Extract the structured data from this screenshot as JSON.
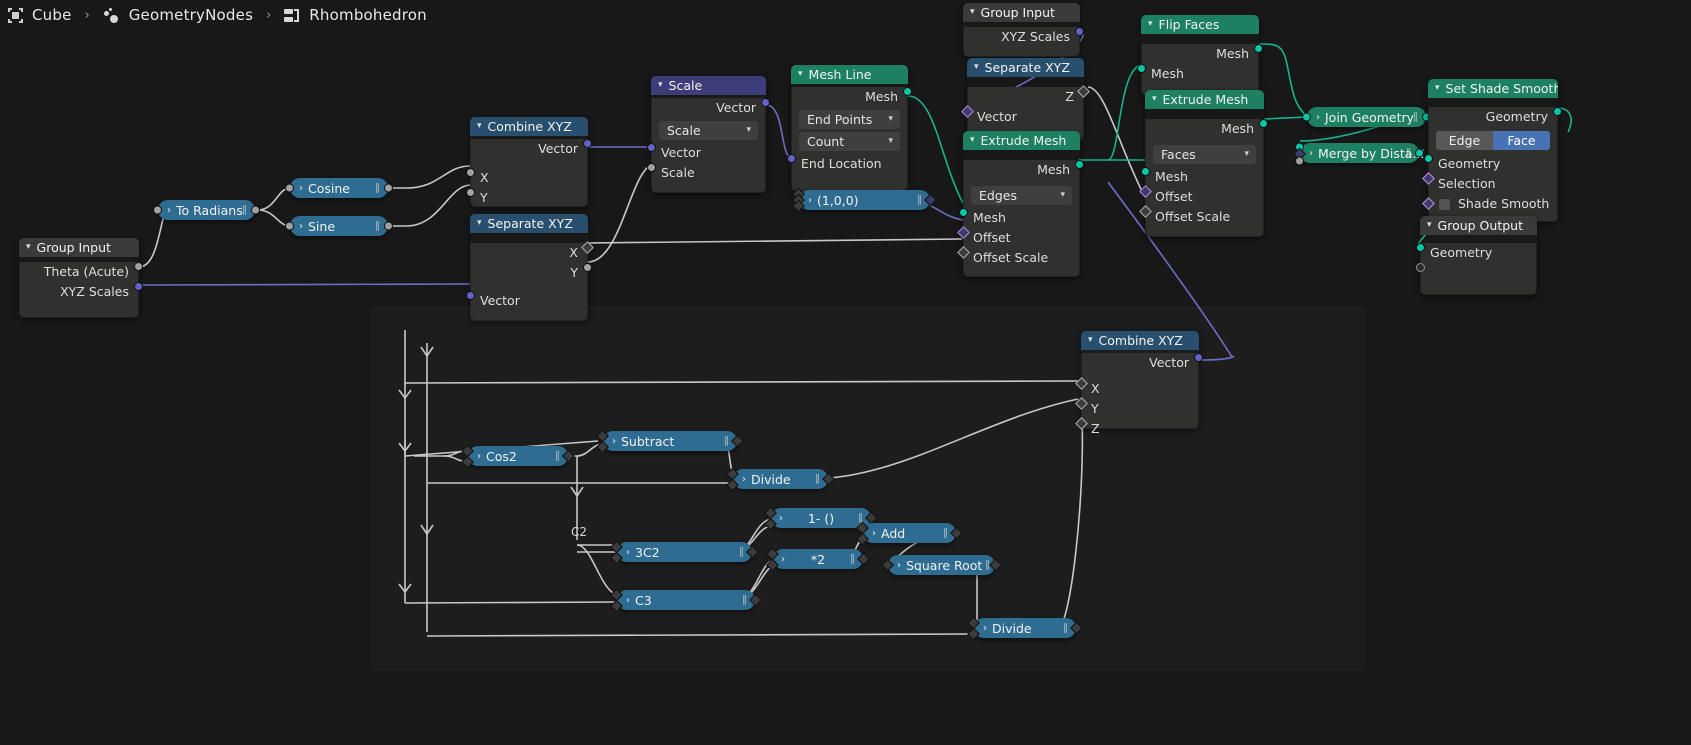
{
  "app": "Blender Geometry Node Editor",
  "breadcrumb": {
    "items": [
      {
        "icon": "object-icon",
        "label": "Cube"
      },
      {
        "icon": "geometry-nodes-icon",
        "label": "GeometryNodes"
      },
      {
        "icon": "node-tree-icon",
        "label": "Rhombohedron"
      }
    ],
    "separator": "›"
  },
  "colors": {
    "header_blue": "#28506e",
    "header_green": "#1d8062",
    "header_purple": "#3d3d7a",
    "node_body": "#30302f",
    "canvas_bg": "#181818",
    "frame_bg": "#1d1d1d",
    "socket_geometry": "#00c7a7",
    "socket_vector": "#6363c7",
    "socket_float": "#a1a1a1",
    "toggle_active": "#4772b3",
    "wire_geometry": "#00c7a7",
    "wire_vector": "#6363c7",
    "wire_float": "#c8c8c8"
  },
  "nodes": {
    "group_input_left": {
      "title": "Group Input",
      "outputs": [
        "Theta (Acute)",
        "XYZ Scales"
      ]
    },
    "to_radians": {
      "title": "To Radians"
    },
    "cosine": {
      "title": "Cosine"
    },
    "sine": {
      "title": "Sine"
    },
    "combine_xyz_top": {
      "title": "Combine XYZ",
      "outputs": [
        "Vector"
      ],
      "inputs": [
        "X",
        "Y"
      ]
    },
    "separate_xyz_left": {
      "title": "Separate XYZ",
      "outputs": [
        "X",
        "Y"
      ],
      "inputs": [
        "Vector"
      ]
    },
    "scale": {
      "title": "Scale",
      "outputs": [
        "Vector"
      ],
      "operation": "Scale",
      "inputs": [
        "Vector",
        "Scale"
      ]
    },
    "mesh_line": {
      "title": "Mesh Line",
      "outputs": [
        "Mesh"
      ],
      "mode": "End Points",
      "count_mode": "Count",
      "inputs": [
        "End Location"
      ]
    },
    "vector_100": {
      "title": "(1,0,0)"
    },
    "group_input_top": {
      "title": "Group Input",
      "outputs": [
        "XYZ Scales"
      ]
    },
    "separate_xyz_top": {
      "title": "Separate XYZ",
      "outputs": [
        "Z"
      ],
      "inputs": [
        "Vector"
      ]
    },
    "extrude_mesh_edges": {
      "title": "Extrude Mesh",
      "outputs": [
        "Mesh"
      ],
      "mode": "Edges",
      "inputs": [
        "Mesh",
        "Offset",
        "Offset Scale"
      ]
    },
    "flip_faces": {
      "title": "Flip Faces",
      "outputs": [
        "Mesh"
      ],
      "inputs": [
        "Mesh"
      ]
    },
    "extrude_mesh_faces": {
      "title": "Extrude Mesh",
      "outputs": [
        "Mesh"
      ],
      "mode": "Faces",
      "inputs": [
        "Mesh",
        "Offset",
        "Offset Scale"
      ]
    },
    "join_geometry": {
      "title": "Join Geometry"
    },
    "merge_by_distance": {
      "title": "Merge by Dista..."
    },
    "set_shade_smooth": {
      "title": "Set Shade Smooth",
      "outputs": [
        "Geometry"
      ],
      "domain_options": [
        "Edge",
        "Face"
      ],
      "domain_active": "Face",
      "inputs": [
        "Geometry",
        "Selection",
        "Shade Smooth"
      ]
    },
    "group_output": {
      "title": "Group Output",
      "inputs": [
        "Geometry"
      ]
    },
    "combine_xyz_bottom": {
      "title": "Combine XYZ",
      "outputs": [
        "Vector"
      ],
      "inputs": [
        "X",
        "Y",
        "Z"
      ]
    },
    "cos2": {
      "title": "Cos2"
    },
    "subtract": {
      "title": "Subtract"
    },
    "divide_top": {
      "title": "Divide"
    },
    "one_minus": {
      "title": "1- ()"
    },
    "three_c2": {
      "title": "3C2"
    },
    "times2": {
      "title": "*2"
    },
    "c3": {
      "title": "C3"
    },
    "add": {
      "title": "Add"
    },
    "square_root": {
      "title": "Square Root"
    },
    "divide_bottom": {
      "title": "Divide"
    },
    "frame_label_c2": "C2"
  }
}
